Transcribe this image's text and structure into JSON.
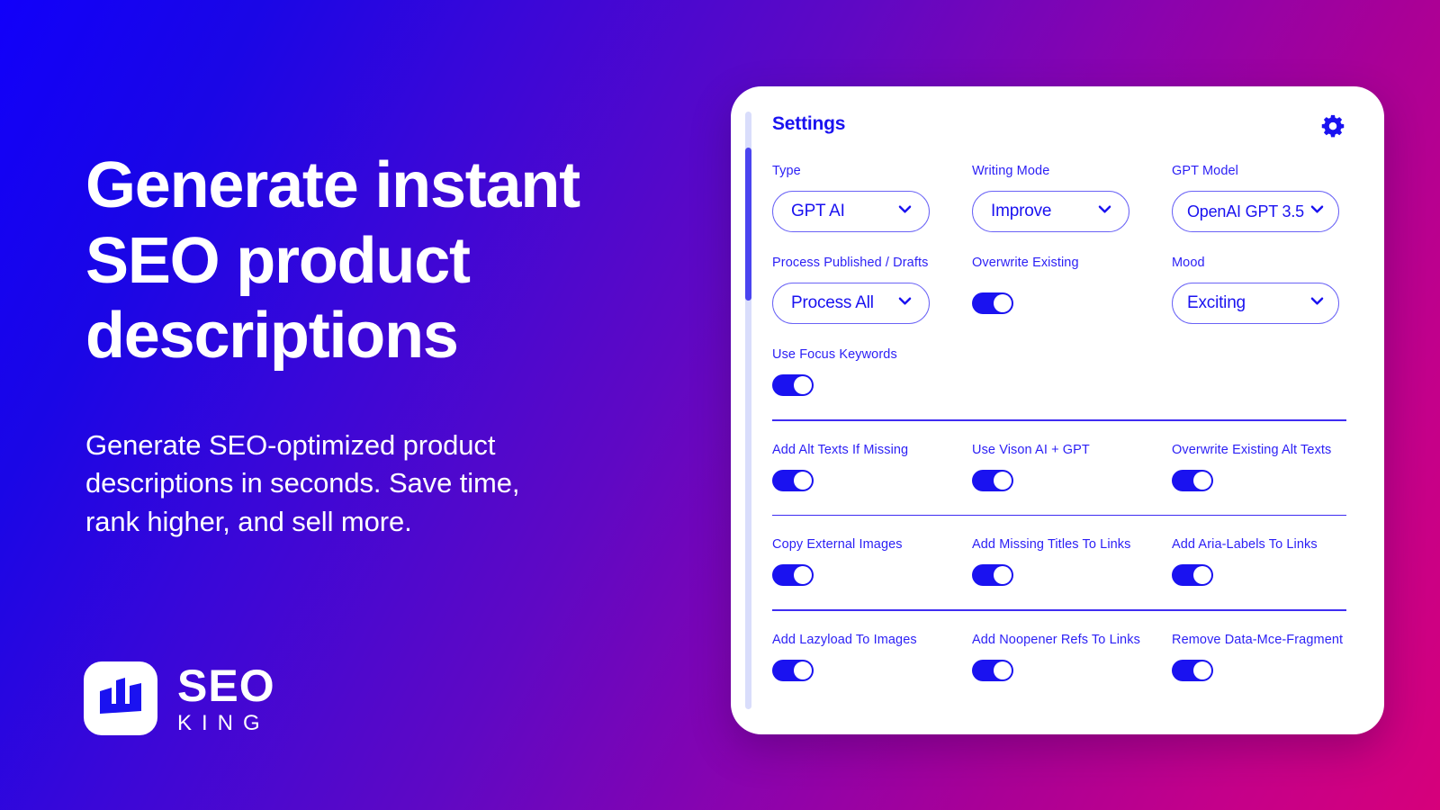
{
  "background": {
    "gradient_from": "#1100fa",
    "gradient_mid": "#5f08c4",
    "gradient_to": "#d6007b"
  },
  "hero": {
    "title": "Generate instant\nSEO product\ndescriptions",
    "subtitle": "Generate SEO-optimized product\ndescriptions in seconds. Save time,\nrank higher, and sell more."
  },
  "logo": {
    "mark_icon": "crown-bar-chart-icon",
    "name": "SEO",
    "tagline": "KING",
    "mark_color": "#1a12f0",
    "mark_bg": "#ffffff"
  },
  "card": {
    "title": "Settings",
    "gear_icon": "gear-icon",
    "accent_color": "#1a12f0",
    "scrollbar": {
      "track_color": "#d9ddfb",
      "thumb_color": "#4a44ef"
    },
    "selects": [
      {
        "label": "Type",
        "value": "GPT AI",
        "icon": "chevron-down-icon"
      },
      {
        "label": "Writing Mode",
        "value": "Improve",
        "icon": "chevron-down-icon"
      },
      {
        "label": "GPT Model",
        "value": "OpenAI GPT 3.5",
        "icon": "chevron-down-icon"
      },
      {
        "label": "Process Published / Drafts",
        "value": "Process All",
        "icon": "chevron-down-icon"
      },
      {
        "label": "Mood",
        "value": "Exciting",
        "icon": "chevron-down-icon"
      }
    ],
    "overwrite_existing": {
      "label": "Overwrite Existing",
      "state": "on"
    },
    "use_focus_keywords": {
      "label": "Use Focus Keywords",
      "state": "on"
    },
    "toggle_rows": [
      [
        {
          "label": "Add Alt Texts If Missing",
          "state": "on"
        },
        {
          "label": "Use Vison AI + GPT",
          "state": "on"
        },
        {
          "label": "Overwrite Existing Alt Texts",
          "state": "on"
        }
      ],
      [
        {
          "label": "Copy External Images",
          "state": "on"
        },
        {
          "label": "Add Missing Titles To Links",
          "state": "on"
        },
        {
          "label": "Add Aria-Labels To Links",
          "state": "on"
        }
      ],
      [
        {
          "label": "Add Lazyload To Images",
          "state": "on"
        },
        {
          "label": "Add Noopener Refs To Links",
          "state": "on"
        },
        {
          "label": "Remove Data-Mce-Fragment",
          "state": "on"
        }
      ]
    ]
  }
}
